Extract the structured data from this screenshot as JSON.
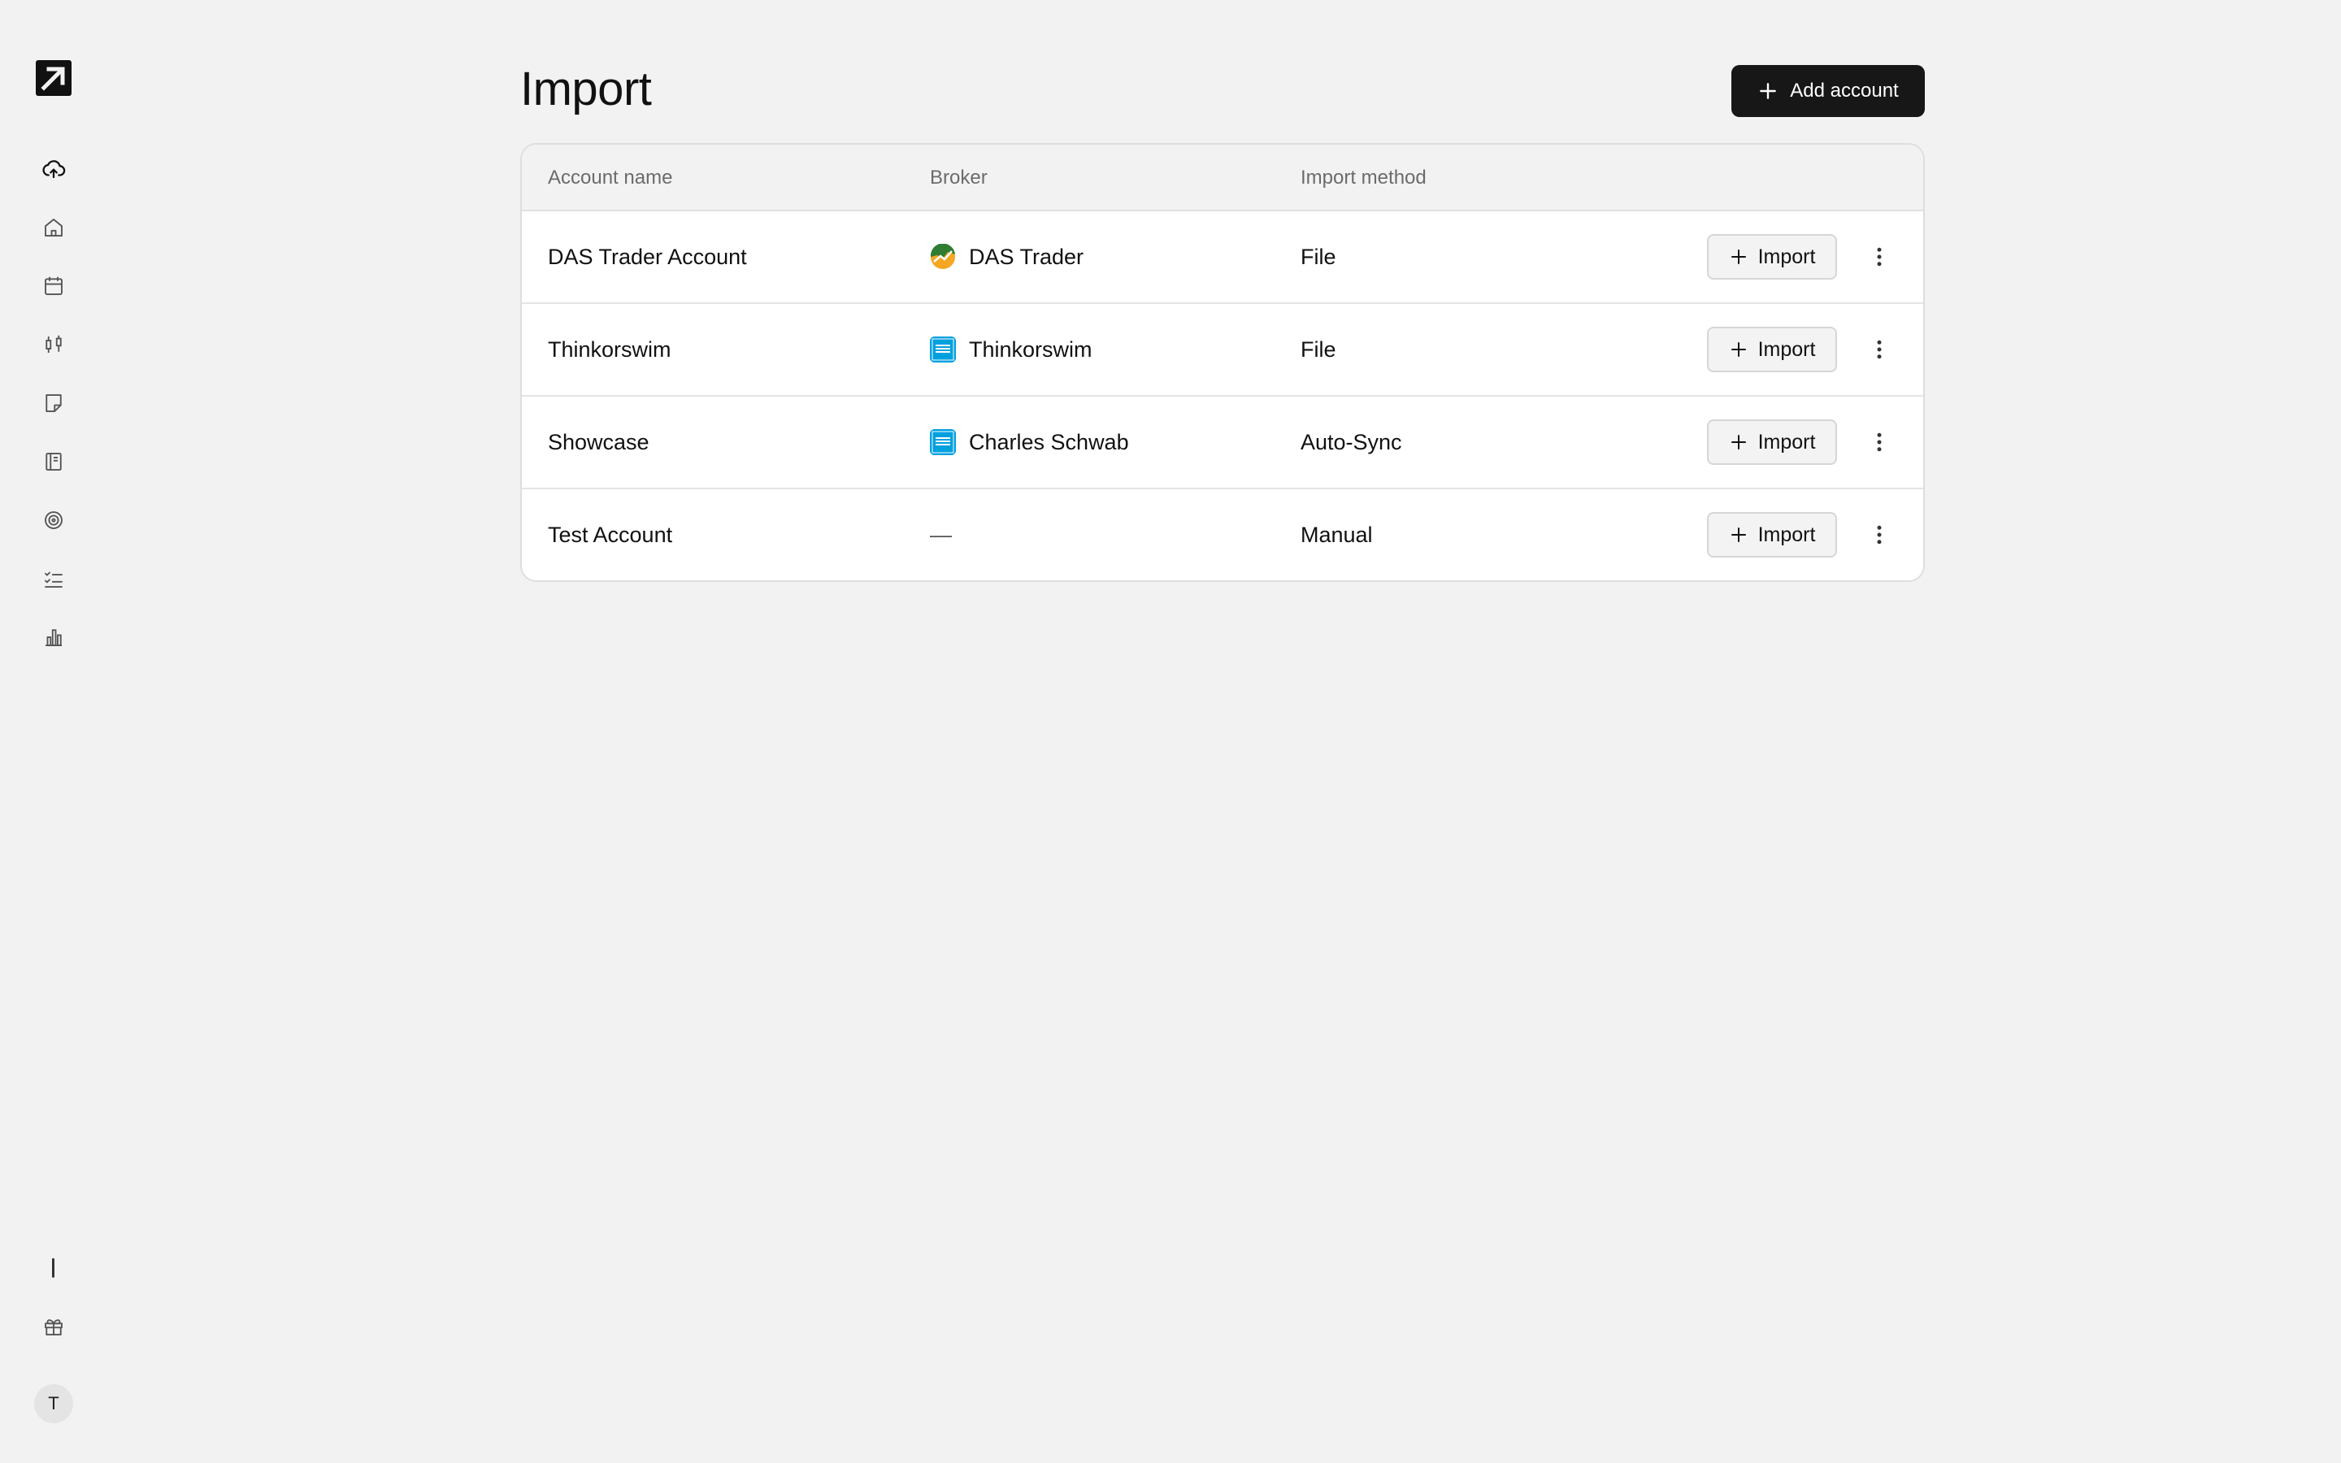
{
  "page": {
    "title": "Import",
    "add_button_label": "Add account"
  },
  "sidebar": {
    "items": [
      {
        "icon": "cloud-upload-icon"
      },
      {
        "icon": "home-icon"
      },
      {
        "icon": "calendar-icon"
      },
      {
        "icon": "candlestick-icon"
      },
      {
        "icon": "note-icon"
      },
      {
        "icon": "notebook-icon"
      },
      {
        "icon": "target-icon"
      },
      {
        "icon": "checklist-icon"
      },
      {
        "icon": "bar-chart-icon"
      }
    ],
    "bottom": [
      {
        "icon": "gift-icon"
      }
    ],
    "avatar_initial": "T"
  },
  "table": {
    "headers": [
      "Account name",
      "Broker",
      "Import method"
    ],
    "rows": [
      {
        "account": "DAS Trader Account",
        "broker": "DAS Trader",
        "broker_logo": "das-trader-logo",
        "method": "File",
        "action": "Import"
      },
      {
        "account": "Thinkorswim",
        "broker": "Thinkorswim",
        "broker_logo": "schwab-logo",
        "method": "File",
        "action": "Import"
      },
      {
        "account": "Showcase",
        "broker": "Charles Schwab",
        "broker_logo": "schwab-logo",
        "method": "Auto-Sync",
        "action": "Import"
      },
      {
        "account": "Test Account",
        "broker": "—",
        "broker_logo": "",
        "method": "Manual",
        "action": "Import"
      }
    ]
  },
  "colors": {
    "background": "#f2f2f2",
    "primary_button": "#171717",
    "schwab_blue": "#00a0df",
    "das_green": "#2e7d32",
    "das_orange": "#f5a623"
  }
}
